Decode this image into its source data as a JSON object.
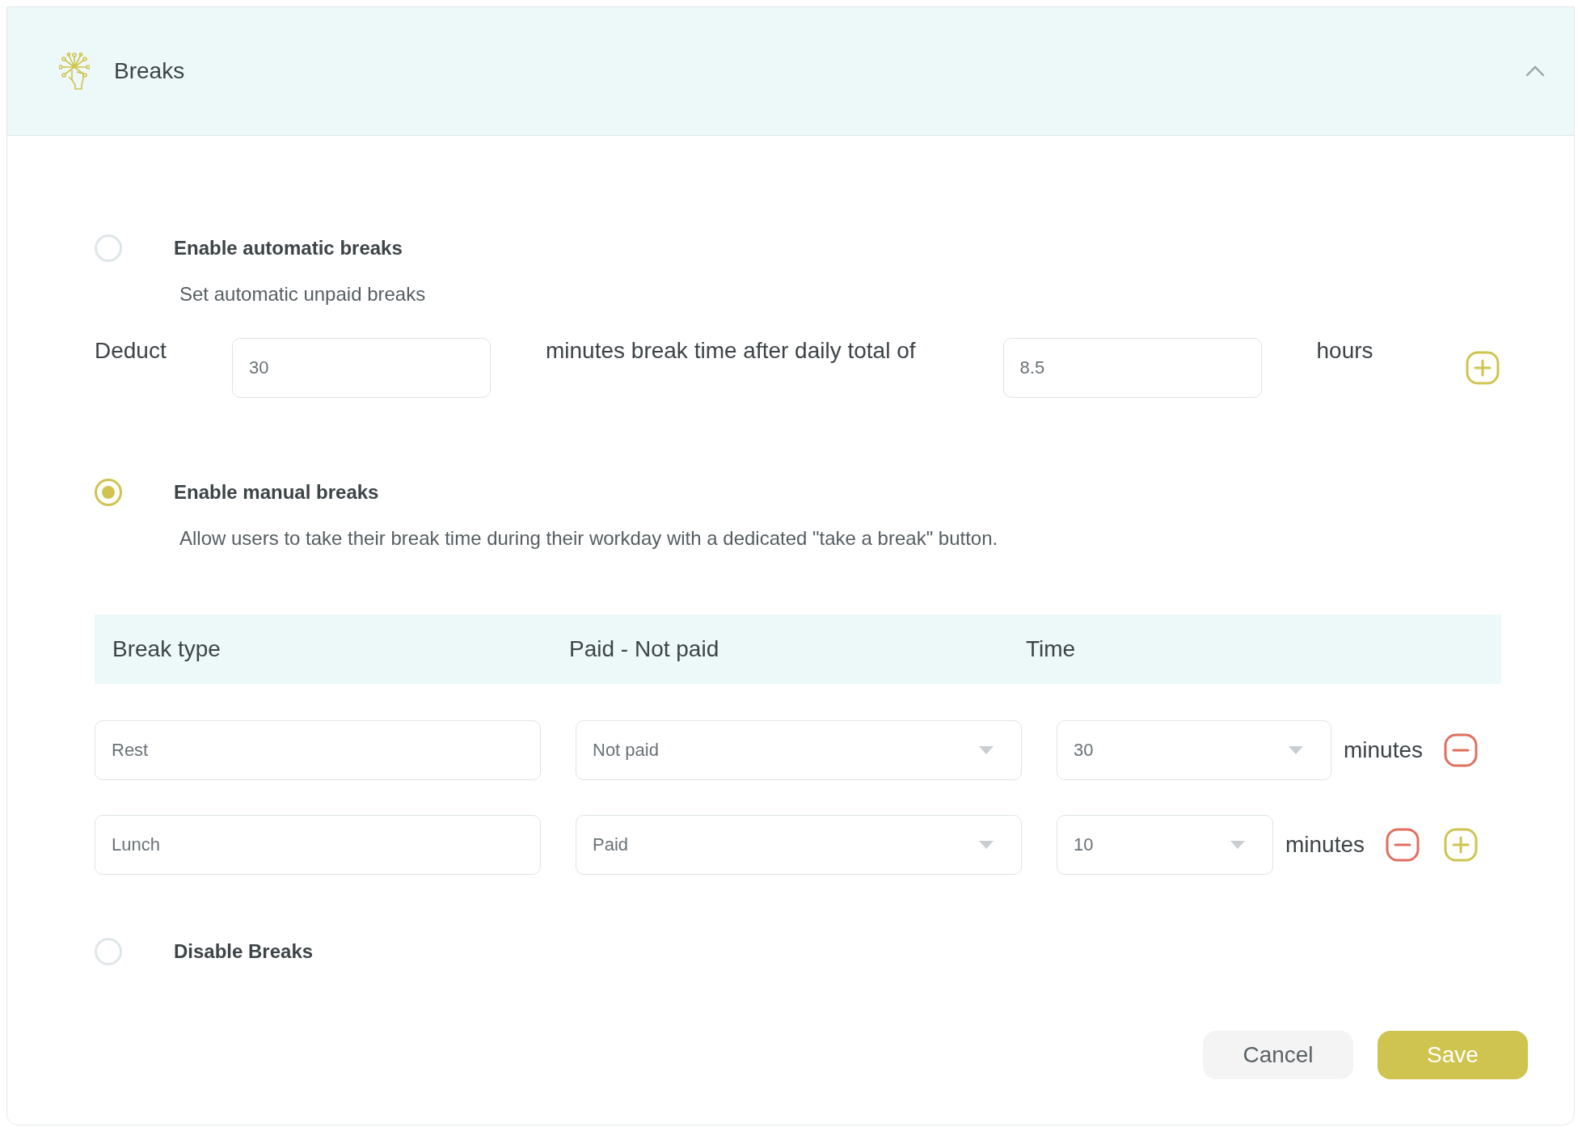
{
  "section": {
    "title": "Breaks",
    "expanded": true
  },
  "options": [
    {
      "kind": "automatic",
      "label": "Enable automatic breaks",
      "description": "Set automatic unpaid breaks",
      "selected": false,
      "rule": {
        "lead": "Deduct",
        "minutes": "30",
        "middle": "minutes break time after daily total of",
        "hours": "8.5",
        "unit": "hours"
      }
    },
    {
      "kind": "manual",
      "label": "Enable manual breaks",
      "description": "Allow users to take their break time during their workday with a dedicated \"take a break\" button.",
      "selected": true,
      "table": {
        "columns": [
          "Break type",
          "Paid - Not paid",
          "Time"
        ],
        "rows": [
          {
            "name": "Rest",
            "pay": "Not paid",
            "time": "30",
            "unit": "minutes",
            "can_add": false
          },
          {
            "name": "Lunch",
            "pay": "Paid",
            "time": "10",
            "unit": "minutes",
            "can_add": true
          }
        ]
      }
    },
    {
      "kind": "disable",
      "label": "Disable Breaks",
      "selected": false
    }
  ],
  "actions": [
    {
      "label": "Cancel",
      "kind": "secondary"
    },
    {
      "label": "Save",
      "kind": "primary"
    }
  ]
}
